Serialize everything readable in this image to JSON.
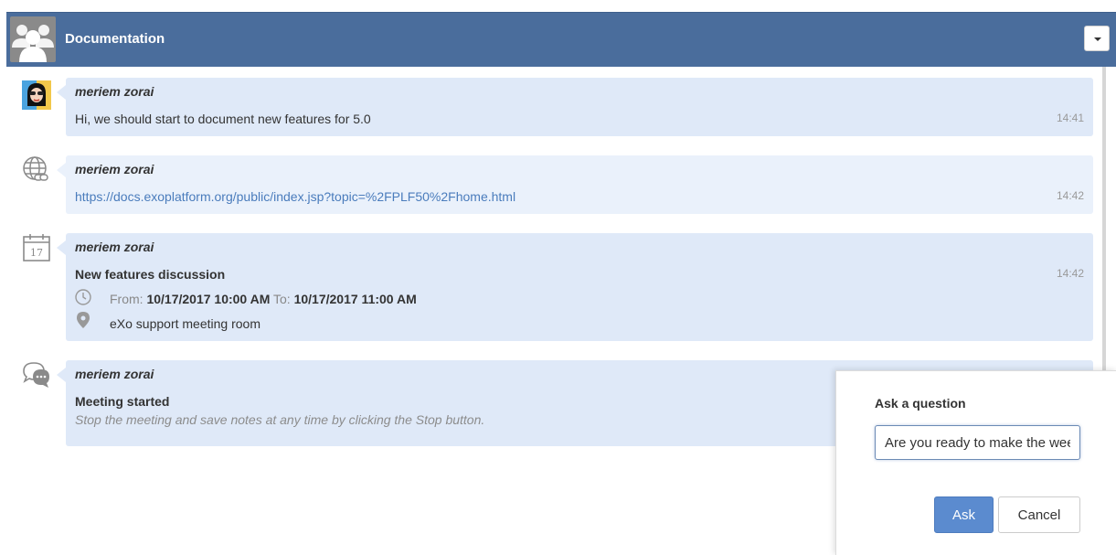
{
  "room": {
    "title": "Documentation",
    "avatar_icon": "group-users-icon"
  },
  "messages": [
    {
      "author": "meriem zorai",
      "icon": "user-avatar",
      "text": "Hi, we should start to document new features for 5.0",
      "time": "14:41"
    },
    {
      "author": "meriem zorai",
      "icon": "link-icon",
      "link": "https://docs.exoplatform.org/public/index.jsp?topic=%2FPLF50%2Fhome.html",
      "time": "14:42"
    },
    {
      "author": "meriem zorai",
      "icon": "calendar-icon",
      "calendar_day": "17",
      "event_title": "New features discussion",
      "from_label": "From:",
      "from_value": "10/17/2017 10:00 AM",
      "to_label": "To:",
      "to_value": "10/17/2017 11:00 AM",
      "location": "eXo support meeting room",
      "time": "14:42"
    },
    {
      "author": "meriem zorai",
      "icon": "chat-bubbles-icon",
      "title": "Meeting started",
      "note": "Stop the meeting and save notes at any time by clicking the Stop button."
    }
  ],
  "ask_popup": {
    "title": "Ask a question",
    "input_value": "Are you ready to make the wee",
    "ask_label": "Ask",
    "cancel_label": "Cancel"
  },
  "colors": {
    "header": "#4a6d9c",
    "bubble": "#dfe9f8",
    "link": "#4a7cbc",
    "primary_button": "#5b8bcf"
  }
}
